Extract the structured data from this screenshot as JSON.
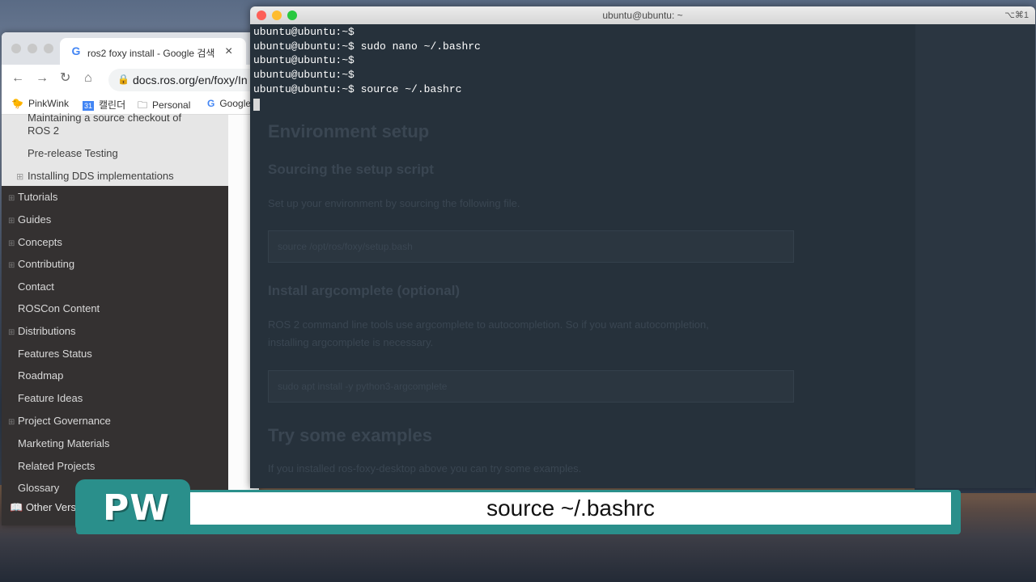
{
  "browser": {
    "tab_title": "ros2 foxy install - Google 검색",
    "tab_close": "×",
    "url": "docs.ros.org/en/foxy/In",
    "nav": {
      "back": "←",
      "forward": "→",
      "reload": "↻",
      "home": "⌂",
      "lock": "🔒"
    },
    "bookmarks": [
      {
        "label": "PinkWink",
        "icon": "🐤"
      },
      {
        "label": "캘린더",
        "icon": "31"
      },
      {
        "label": "Personal",
        "icon": "🗀"
      },
      {
        "label": "Google",
        "icon": "G"
      }
    ],
    "sidebar_sub": {
      "item0": "Maintaining a source checkout of",
      "item0b": "ROS 2",
      "item1": "Pre-release Testing",
      "item2": "Installing DDS implementations"
    },
    "sidebar_nav": [
      "Tutorials",
      "Guides",
      "Concepts",
      "Contributing",
      "Contact",
      "ROSCon Content",
      "Distributions",
      "Features Status",
      "Roadmap",
      "Feature Ideas",
      "Project Governance",
      "Marketing Materials",
      "Related Projects",
      "Glossary"
    ],
    "other_versions": "Other Versi"
  },
  "terminal": {
    "title": "ubuntu@ubuntu: ~",
    "shortcut": "⌥⌘1",
    "lines": [
      {
        "prompt": "ubuntu@ubuntu:~$",
        "cmd": ""
      },
      {
        "prompt": "ubuntu@ubuntu:~$",
        "cmd": " sudo nano ~/.bashrc"
      },
      {
        "prompt": "ubuntu@ubuntu:~$",
        "cmd": ""
      },
      {
        "prompt": "ubuntu@ubuntu:~$",
        "cmd": ""
      },
      {
        "prompt": "ubuntu@ubuntu:~$",
        "cmd": " source ~/.bashrc"
      }
    ],
    "ghost": {
      "h1": "Environment setup",
      "h2a": "Sourcing the setup script",
      "p1": "Set up your environment by sourcing the following file.",
      "code1": "source /opt/ros/foxy/setup.bash",
      "h2b": "Install argcomplete (optional)",
      "p2a": "ROS 2 command line tools use argcomplete to autocompletion. So if you want autocompletion,",
      "p2b": "installing argcomplete is necessary.",
      "code2": "sudo apt install -y python3-argcomplete",
      "h1b": "Try some examples",
      "p3": "If you installed ros-foxy-desktop above you can try some examples."
    }
  },
  "caption": {
    "logo": "PW",
    "text": "source ~/.bashrc"
  },
  "colors": {
    "terminal_bg": "#26313b",
    "caption_teal": "#2a8f8b",
    "sidebar_dark": "#343131"
  }
}
